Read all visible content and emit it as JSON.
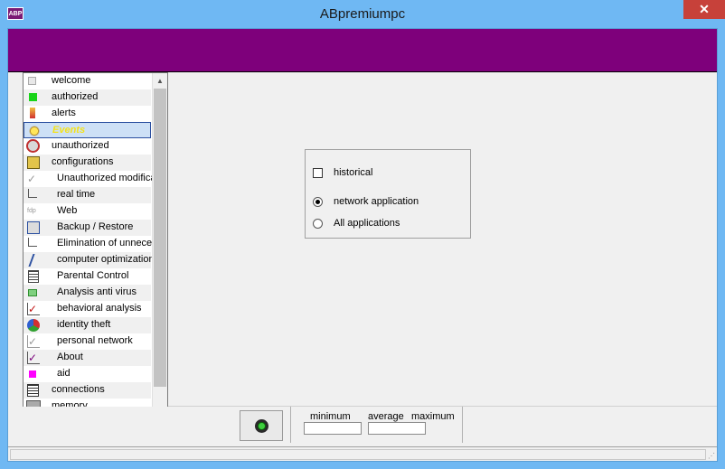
{
  "app": {
    "title": "ABpremiumpc",
    "icon_text": "ABP",
    "close_glyph": "✕",
    "banner_color": "#7e007b"
  },
  "sidebar": {
    "items": [
      {
        "label": "welcome",
        "icon": "welcome-icon",
        "sub": false
      },
      {
        "label": "authorized",
        "icon": "green-square-icon",
        "sub": false
      },
      {
        "label": "alerts",
        "icon": "alert-person-icon",
        "sub": false
      },
      {
        "label": "Events",
        "icon": "lightbulb-icon",
        "sub": false,
        "selected": true
      },
      {
        "label": "unauthorized",
        "icon": "no-entry-icon",
        "sub": false
      },
      {
        "label": "configurations",
        "icon": "settings-icon",
        "sub": false
      },
      {
        "label": "Unauthorized modifications",
        "icon": "check-icon",
        "sub": true
      },
      {
        "label": "real time",
        "icon": "realtime-icon",
        "sub": true
      },
      {
        "label": "Web",
        "icon": "web-icon",
        "sub": true
      },
      {
        "label": "Backup / Restore",
        "icon": "backup-icon",
        "sub": true
      },
      {
        "label": "Elimination of unnecessary files",
        "icon": "elimination-icon",
        "sub": true
      },
      {
        "label": "computer optimization",
        "icon": "optimization-icon",
        "sub": true
      },
      {
        "label": "Parental Control",
        "icon": "parental-control-icon",
        "sub": true
      },
      {
        "label": "Analysis anti virus",
        "icon": "antivirus-icon",
        "sub": true
      },
      {
        "label": "behavioral analysis",
        "icon": "red-check-icon",
        "sub": true
      },
      {
        "label": "identity theft",
        "icon": "identity-icon",
        "sub": true
      },
      {
        "label": "personal network",
        "icon": "network-check-icon",
        "sub": true
      },
      {
        "label": "About",
        "icon": "about-check-icon",
        "sub": true
      },
      {
        "label": "aid",
        "icon": "magenta-square-icon",
        "sub": true
      },
      {
        "label": "connections",
        "icon": "connections-icon",
        "sub": false
      },
      {
        "label": "memory",
        "icon": "memory-icon",
        "sub": false
      }
    ]
  },
  "options": {
    "historical": {
      "label": "historical",
      "checked": false
    },
    "radios": [
      {
        "label": "network application",
        "selected": true
      },
      {
        "label": "All applications",
        "selected": false
      }
    ]
  },
  "stats": {
    "minimum_label": "minimum",
    "average_label": "average",
    "maximum_label": "maximum",
    "minimum_value": "",
    "average_value": ""
  }
}
